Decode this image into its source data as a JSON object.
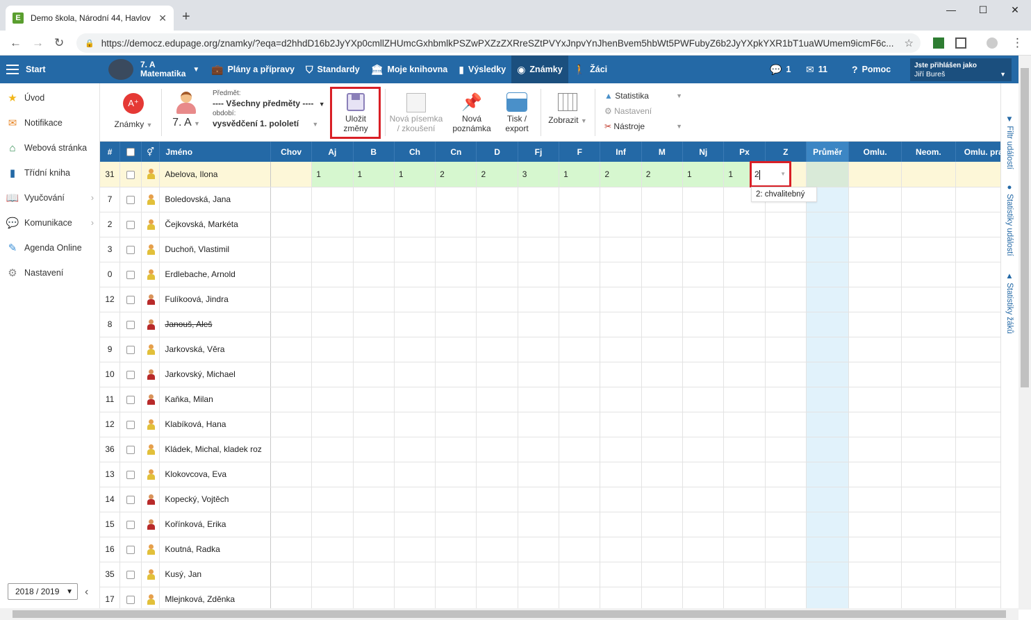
{
  "browser": {
    "tab_title": "Demo škola, Národní 44, Havlov",
    "favicon": "E",
    "url": "https://democz.edupage.org/znamky/?eqa=d2hhdD16b2JyYXp0cmllZHUmcGxhbmlkPSZwPXZzZXRreSZtPVYxJnpvYnJhenBvem5hbWt5PWFubyZ6b2JyYXpkYXR1bT1uaWUmem9icmF6c..."
  },
  "topnav": {
    "start": "Start",
    "class_line1": "7. A",
    "class_line2": "Matematika",
    "items": [
      "Plány a přípravy",
      "Standardy",
      "Moje knihovna",
      "Výsledky",
      "Známky",
      "Žáci"
    ],
    "messages_count": "1",
    "mail_count": "11",
    "help": "Pomoc",
    "logged_in_as": "Jste přihlášen jako",
    "user_name": "Jiří Bureš"
  },
  "sidebar": {
    "items": [
      "Úvod",
      "Notifikace",
      "Webová stránka",
      "Třídní kniha",
      "Vyučování",
      "Komunikace",
      "Agenda Online",
      "Nastavení"
    ],
    "year": "2018 / 2019"
  },
  "toolbar": {
    "znamky_label": "Známky",
    "class_label": "7. A",
    "predmet_caption": "Předmět:",
    "predmet_value": "---- Všechny předměty ----",
    "obdobi_caption": "období:",
    "obdobi_value": "vysvědčení 1. pololetí",
    "save_line1": "Uložit",
    "save_line2": "změny",
    "new_test_line1": "Nová písemka",
    "new_test_line2": "/ zkoušení",
    "new_note_line1": "Nová",
    "new_note_line2": "poznámka",
    "print_line1": "Tisk /",
    "print_line2": "export",
    "view": "Zobrazit",
    "statistika": "Statistika",
    "nastaveni": "Nastavení",
    "nastroje": "Nástroje"
  },
  "right_tabs": [
    "Filtr událostí",
    "Statistiky událostí",
    "Statistiky žáků"
  ],
  "grid": {
    "headers": [
      "#",
      "",
      "",
      "Jméno",
      "Chov",
      "Aj",
      "B",
      "Ch",
      "Cn",
      "D",
      "Fj",
      "F",
      "Inf",
      "M",
      "Nj",
      "Px",
      "Z",
      "Průměr",
      "Omlu.",
      "Neom.",
      "Omlu. praxe"
    ],
    "edit_value": "2",
    "suggestion": "2: chvalitebný",
    "rows": [
      {
        "num": "31",
        "name": "Abelova, Ilona",
        "g": "f",
        "grades": [
          "1",
          "1",
          "1",
          "2",
          "2",
          "3",
          "1",
          "2",
          "2",
          "1",
          "1",
          ""
        ]
      },
      {
        "num": "7",
        "name": "Boledovská, Jana",
        "g": "f"
      },
      {
        "num": "2",
        "name": "Čejkovská, Markéta",
        "g": "f"
      },
      {
        "num": "3",
        "name": "Duchoň, Vlastimil",
        "g": "f"
      },
      {
        "num": "0",
        "name": "Erdlebache, Arnold",
        "g": "f"
      },
      {
        "num": "12",
        "name": "Fulíkoová, Jindra",
        "g": "m"
      },
      {
        "num": "8",
        "name": "Janouš, Aleš",
        "g": "m",
        "strike": true
      },
      {
        "num": "9",
        "name": "Jarkovská, Věra",
        "g": "f"
      },
      {
        "num": "10",
        "name": "Jarkovský, Michael",
        "g": "m"
      },
      {
        "num": "11",
        "name": "Kaňka, Milan",
        "g": "m"
      },
      {
        "num": "12",
        "name": "Klabíková, Hana",
        "g": "f"
      },
      {
        "num": "36",
        "name": "Kládek, Michal, kladek roz",
        "g": "f"
      },
      {
        "num": "13",
        "name": "Klokovcova, Eva",
        "g": "f"
      },
      {
        "num": "14",
        "name": "Kopecký, Vojtěch",
        "g": "m"
      },
      {
        "num": "15",
        "name": "Kořínková, Erika",
        "g": "m"
      },
      {
        "num": "16",
        "name": "Koutná, Radka",
        "g": "f"
      },
      {
        "num": "35",
        "name": "Kusý, Jan",
        "g": "f"
      },
      {
        "num": "17",
        "name": "Mlejnková, Zděnka",
        "g": "f"
      }
    ]
  }
}
